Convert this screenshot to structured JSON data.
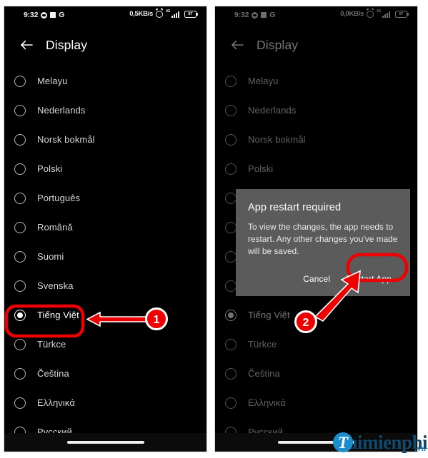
{
  "colors": {
    "annotation_red": "#ee0000",
    "dialog_bg": "#5b5b5b",
    "screen_bg": "#000000",
    "brand_blue": "#1c8ecb",
    "brand_dark_blue": "#11486e"
  },
  "panels": [
    {
      "id": "left",
      "status_bar": {
        "time": "9:32",
        "network_speed": "0,5KB/s",
        "network_type": "4G",
        "battery_level": "87",
        "icons": [
          "messenger-icon",
          "white-square-icon",
          "google-g-icon",
          "alarm-icon",
          "signal-icon",
          "battery-icon"
        ]
      },
      "app_bar": {
        "back_icon": "arrow-left-icon",
        "title": "Display"
      },
      "languages": [
        {
          "label": "Melayu",
          "selected": false
        },
        {
          "label": "Nederlands",
          "selected": false
        },
        {
          "label": "Norsk bokmål",
          "selected": false
        },
        {
          "label": "Polski",
          "selected": false
        },
        {
          "label": "Português",
          "selected": false
        },
        {
          "label": "Română",
          "selected": false
        },
        {
          "label": "Suomi",
          "selected": false
        },
        {
          "label": "Svenska",
          "selected": false
        },
        {
          "label": "Tiếng Việt",
          "selected": true
        },
        {
          "label": "Türkce",
          "selected": false
        },
        {
          "label": "Čeština",
          "selected": false
        },
        {
          "label": "Ελληνικά",
          "selected": false
        },
        {
          "label": "Русский",
          "selected": false
        }
      ],
      "annotation": {
        "badge": "1",
        "target": "Tiếng Việt row"
      }
    },
    {
      "id": "right",
      "status_bar": {
        "time": "9:32",
        "network_speed": "0,0KB/s",
        "network_type": "4G",
        "battery_level": "87",
        "icons": [
          "messenger-icon",
          "white-square-icon",
          "google-g-icon",
          "alarm-icon",
          "signal-icon",
          "battery-icon"
        ]
      },
      "app_bar": {
        "back_icon": "arrow-left-icon",
        "title": "Display"
      },
      "languages": [
        {
          "label": "Melayu",
          "selected": false
        },
        {
          "label": "Nederlands",
          "selected": false
        },
        {
          "label": "Norsk bokmål",
          "selected": false
        },
        {
          "label": "Polski",
          "selected": false
        },
        {
          "label": "Português",
          "selected": false
        },
        {
          "label": "Română",
          "selected": false
        },
        {
          "label": "Suomi",
          "selected": false
        },
        {
          "label": "Svenska",
          "selected": false
        },
        {
          "label": "Tiếng Việt",
          "selected": true
        },
        {
          "label": "Türkce",
          "selected": false
        },
        {
          "label": "Čeština",
          "selected": false
        },
        {
          "label": "Ελληνικά",
          "selected": false
        },
        {
          "label": "Русский",
          "selected": false
        }
      ],
      "dialog": {
        "title": "App restart required",
        "body": "To view the changes, the app needs to restart. Any other changes you've made will be saved.",
        "cancel_label": "Cancel",
        "confirm_label": "Restart App"
      },
      "annotation": {
        "badge": "2",
        "target": "Restart App button"
      }
    }
  ],
  "watermark": {
    "logo_letter": "T",
    "text": "aimienphi",
    "tld": ".vn"
  }
}
